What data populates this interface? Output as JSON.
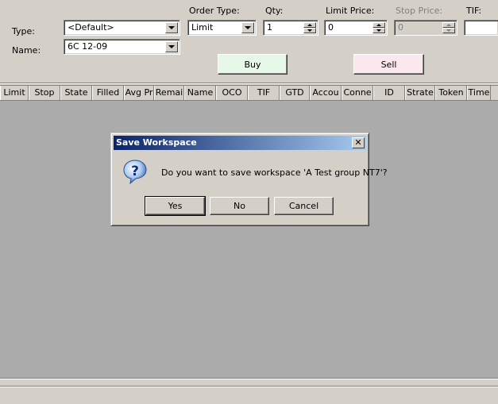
{
  "order_entry": {
    "type_label": "Type:",
    "type_value": "<Default>",
    "name_label": "Name:",
    "name_value": "6C 12-09",
    "order_type_label": "Order Type:",
    "order_type_value": "Limit",
    "qty_label": "Qty:",
    "qty_value": "1",
    "limit_price_label": "Limit Price:",
    "limit_price_value": "0",
    "stop_price_label": "Stop Price:",
    "stop_price_value": "0",
    "tif_label": "TIF:",
    "tif_value": "",
    "buy_label": "Buy",
    "sell_label": "Sell",
    "buy_color": "#e8f8e8",
    "sell_color": "#fbe8ee"
  },
  "grid": {
    "columns": [
      "Limit",
      "Stop",
      "State",
      "Filled",
      "Avg Pr",
      "Remai",
      "Name",
      "OCO",
      "TIF",
      "GTD",
      "Accou",
      "Conne",
      "ID",
      "Strate",
      "Token",
      "Time"
    ]
  },
  "dialog": {
    "title": "Save Workspace",
    "close_glyph": "✕",
    "message": "Do you want to save workspace 'A Test group NT7'?",
    "icon": "question-icon",
    "buttons": {
      "yes": "Yes",
      "no": "No",
      "cancel": "Cancel"
    }
  }
}
